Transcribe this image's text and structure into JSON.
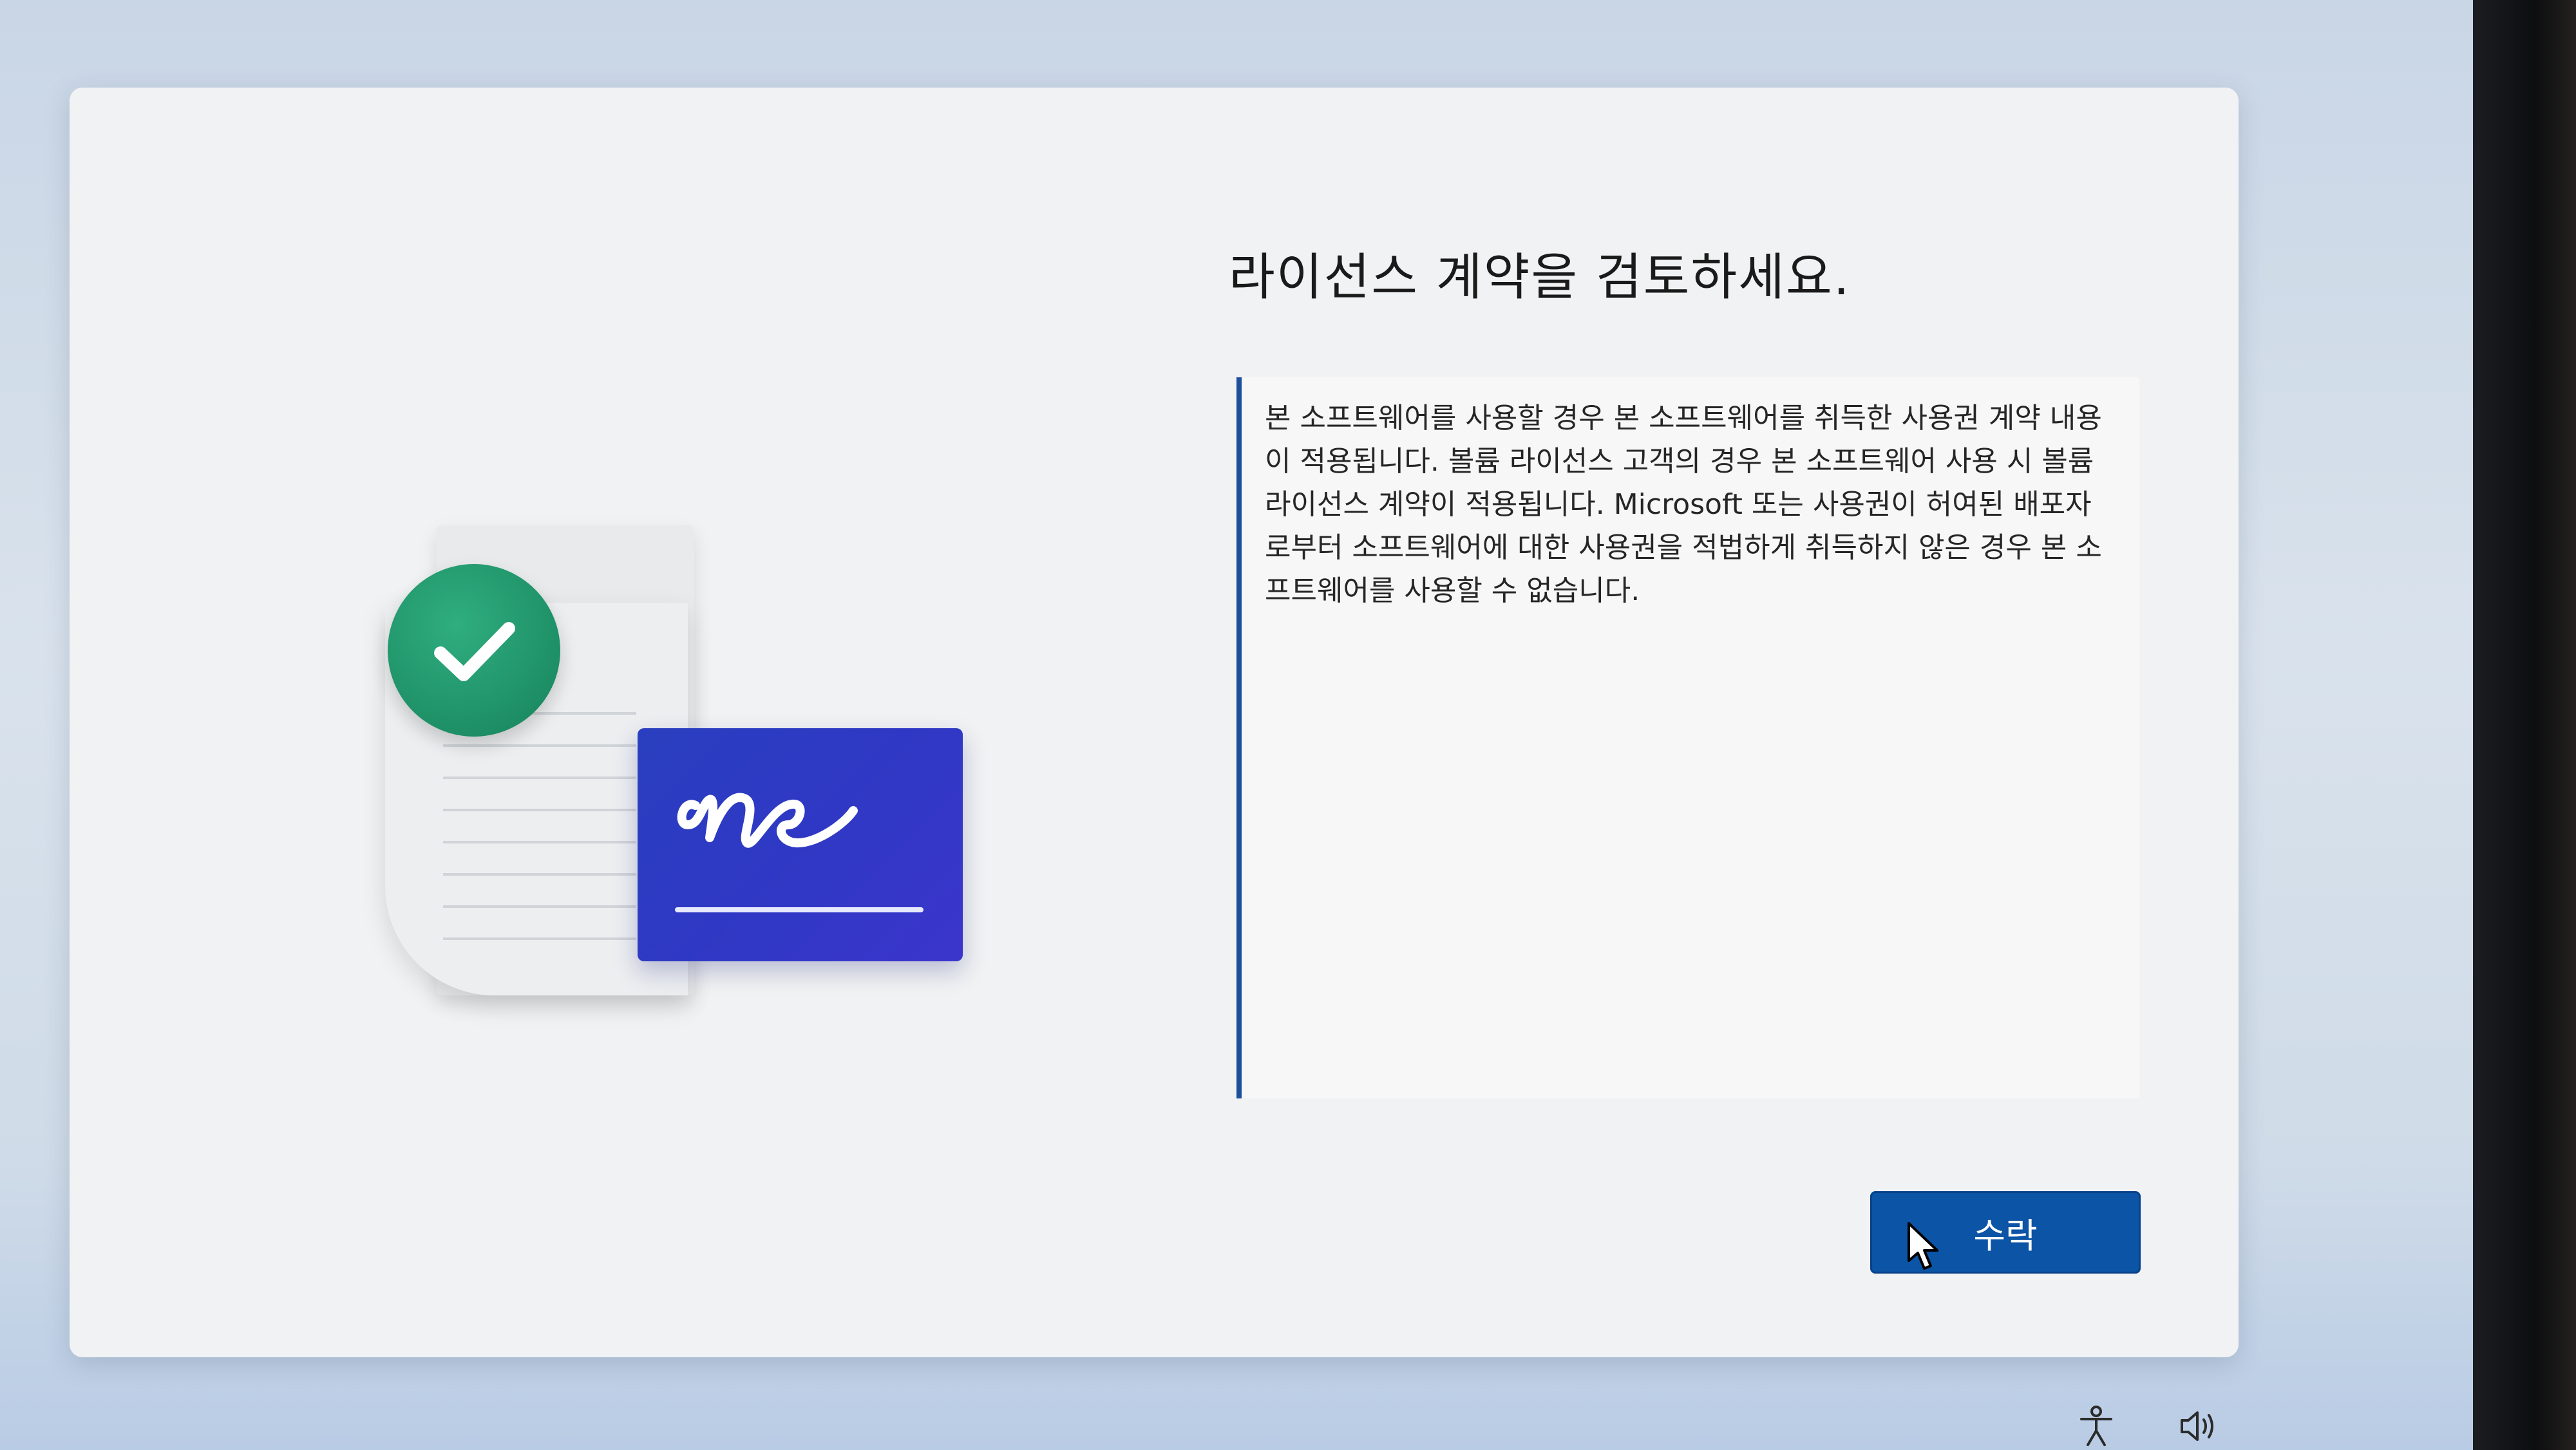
{
  "dialog": {
    "title": "라이선스 계약을 검토하세요.",
    "license_text": "본 소프트웨어를 사용할 경우 본 소프트웨어를 취득한 사용권 계약 내용이 적용됩니다. 볼륨 라이선스 고객의 경우 본 소프트웨어 사용 시 볼륨 라이선스 계약이 적용됩니다. Microsoft 또는 사용권이 허여된 배포자로부터 소프트웨어에 대한 사용권을 적법하게 취득하지 않은 경우 본 소프트웨어를 사용할 수 없습니다.",
    "accept_label": "수락"
  },
  "colors": {
    "accent": "#0b54a6",
    "scroll_border": "#1e4f9c",
    "check_green": "#1e8f66",
    "signature_blue": "#2f38c4"
  },
  "icons": {
    "illustration": "license-document-illustration",
    "check": "check-icon",
    "signature": "signature-icon",
    "cursor": "cursor-icon",
    "accessibility": "accessibility-icon",
    "volume": "volume-icon"
  }
}
